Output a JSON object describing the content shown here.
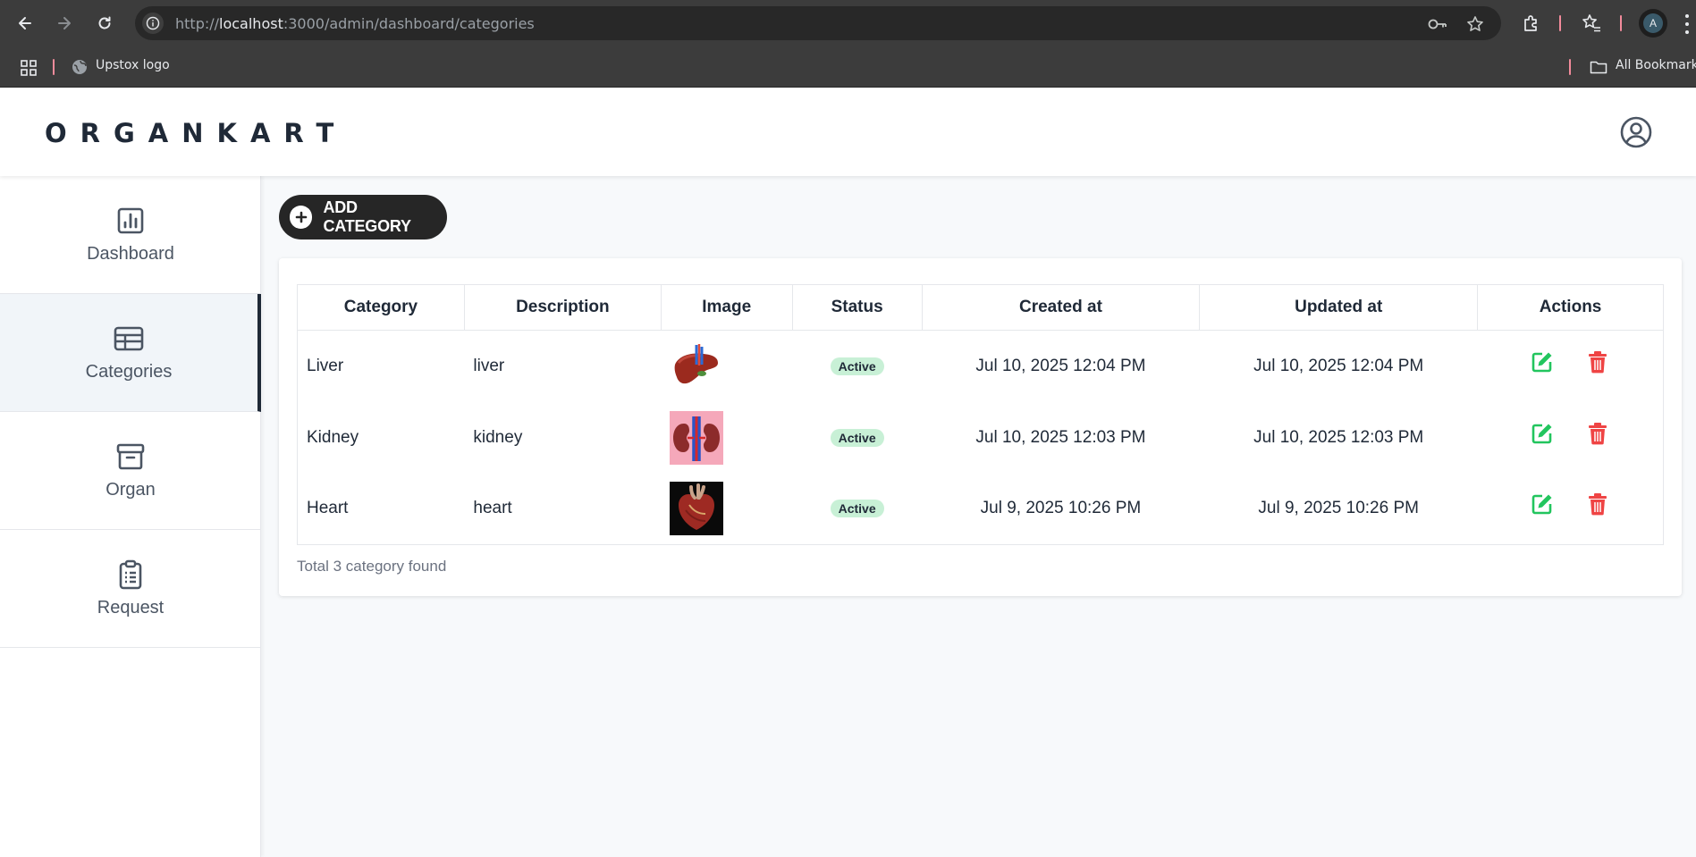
{
  "browser": {
    "url_prefix": "http://",
    "url_host": "localhost",
    "url_path": ":3000/admin/dashboard/categories",
    "bookmark_label": "Upstox logo",
    "all_bookmarks_label": "All Bookmarks",
    "profile_initial": "A"
  },
  "header": {
    "brand": "ORGANKART"
  },
  "sidebar": {
    "items": [
      {
        "label": "Dashboard",
        "icon": "bar-chart-icon"
      },
      {
        "label": "Categories",
        "icon": "table-list-icon"
      },
      {
        "label": "Organ",
        "icon": "archive-box-icon"
      },
      {
        "label": "Request",
        "icon": "clipboard-list-icon"
      }
    ]
  },
  "main": {
    "add_button_label": "ADD CATEGORY",
    "table": {
      "headers": [
        "Category",
        "Description",
        "Image",
        "Status",
        "Created at",
        "Updated at",
        "Actions"
      ],
      "rows": [
        {
          "category": "Liver",
          "description": "liver",
          "image": "liver-image",
          "status": "Active",
          "created": "Jul 10, 2025 12:04 PM",
          "updated": "Jul 10, 2025 12:04 PM"
        },
        {
          "category": "Kidney",
          "description": "kidney",
          "image": "kidney-image",
          "status": "Active",
          "created": "Jul 10, 2025 12:03 PM",
          "updated": "Jul 10, 2025 12:03 PM"
        },
        {
          "category": "Heart",
          "description": "heart",
          "image": "heart-image",
          "status": "Active",
          "created": "Jul 9, 2025 10:26 PM",
          "updated": "Jul 9, 2025 10:26 PM"
        }
      ]
    },
    "footer_note": "Total 3 category found"
  },
  "colors": {
    "brand_text": "#1f2937",
    "active_badge": "#c8f0d6",
    "edit_icon": "#22c55e",
    "delete_icon": "#ef4444",
    "add_button": "#262626"
  }
}
